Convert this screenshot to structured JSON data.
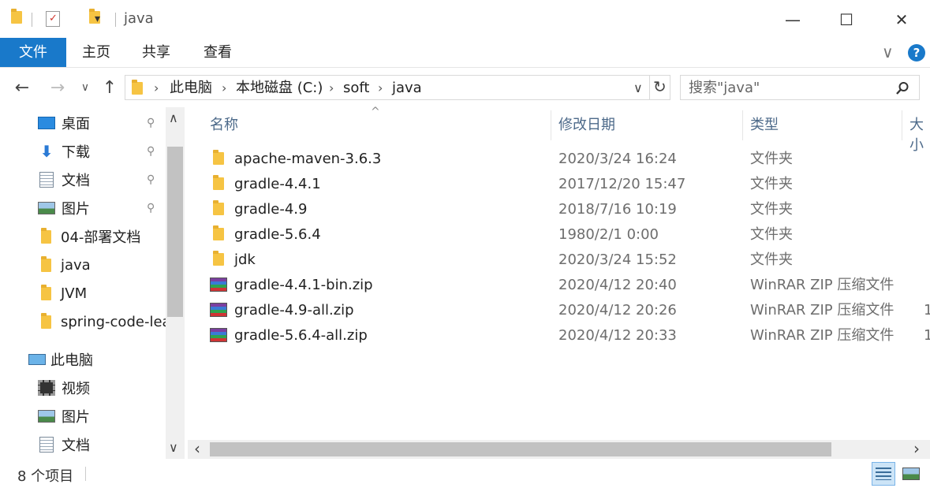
{
  "titlebar": {
    "title": "java",
    "minimize": "—",
    "maximize": "☐",
    "close": "✕",
    "dropdown": "▾"
  },
  "ribbon": {
    "tabs": [
      "文件",
      "主页",
      "共享",
      "查看"
    ],
    "collapse": "∨",
    "help": "?"
  },
  "nav": {
    "back": "←",
    "forward": "→",
    "recent": "∨",
    "up": "↑",
    "breadcrumb": [
      "此电脑",
      "本地磁盘 (C:)",
      "soft",
      "java"
    ],
    "crumb_sep": "›",
    "address_dropdown": "∨",
    "refresh": "↻",
    "search_placeholder": "搜索\"java\"",
    "search_icon": "search-icon"
  },
  "navpane": {
    "quick_access": [
      {
        "label": "桌面",
        "icon": "desktop-icon",
        "pinned": true
      },
      {
        "label": "下载",
        "icon": "download-icon",
        "pinned": true
      },
      {
        "label": "文档",
        "icon": "document-icon",
        "pinned": true
      },
      {
        "label": "图片",
        "icon": "pictures-icon",
        "pinned": true
      },
      {
        "label": "04-部署文档",
        "icon": "folder-icon",
        "pinned": false
      },
      {
        "label": "java",
        "icon": "folder-icon",
        "pinned": false
      },
      {
        "label": "JVM",
        "icon": "folder-icon",
        "pinned": false
      },
      {
        "label": "spring-code-lea",
        "icon": "folder-icon",
        "pinned": false
      }
    ],
    "this_pc": "此电脑",
    "pc_items": [
      {
        "label": "视频",
        "icon": "video-icon"
      },
      {
        "label": "图片",
        "icon": "pictures-icon"
      },
      {
        "label": "文档",
        "icon": "document-icon"
      }
    ],
    "pin_glyph": "📌",
    "scroll_up": "∧",
    "scroll_down": "∨"
  },
  "filelist": {
    "sort_indicator": "^",
    "columns": [
      "名称",
      "修改日期",
      "类型",
      "大小"
    ],
    "rows": [
      {
        "name": "apache-maven-3.6.3",
        "date": "2020/3/24 16:24",
        "type": "文件夹",
        "size": "",
        "kind": "folder"
      },
      {
        "name": "gradle-4.4.1",
        "date": "2017/12/20 15:47",
        "type": "文件夹",
        "size": "",
        "kind": "folder"
      },
      {
        "name": "gradle-4.9",
        "date": "2018/7/16 10:19",
        "type": "文件夹",
        "size": "",
        "kind": "folder"
      },
      {
        "name": "gradle-5.6.4",
        "date": "1980/2/1 0:00",
        "type": "文件夹",
        "size": "",
        "kind": "folder"
      },
      {
        "name": "jdk",
        "date": "2020/3/24 15:52",
        "type": "文件夹",
        "size": "",
        "kind": "folder"
      },
      {
        "name": "gradle-4.4.1-bin.zip",
        "date": "2020/4/12 20:40",
        "type": "WinRAR ZIP 压缩文件",
        "size": "",
        "kind": "zip"
      },
      {
        "name": "gradle-4.9-all.zip",
        "date": "2020/4/12 20:26",
        "type": "WinRAR ZIP 压缩文件",
        "size": "1",
        "kind": "zip"
      },
      {
        "name": "gradle-5.6.4-all.zip",
        "date": "2020/4/12 20:33",
        "type": "WinRAR ZIP 压缩文件",
        "size": "1",
        "kind": "zip"
      }
    ],
    "scroll_left": "‹",
    "scroll_right": "›"
  },
  "status": {
    "item_count": "8 个项目"
  },
  "colors": {
    "accent": "#1979ca",
    "folder": "#f6c443",
    "header_text": "#4d6a8a"
  }
}
